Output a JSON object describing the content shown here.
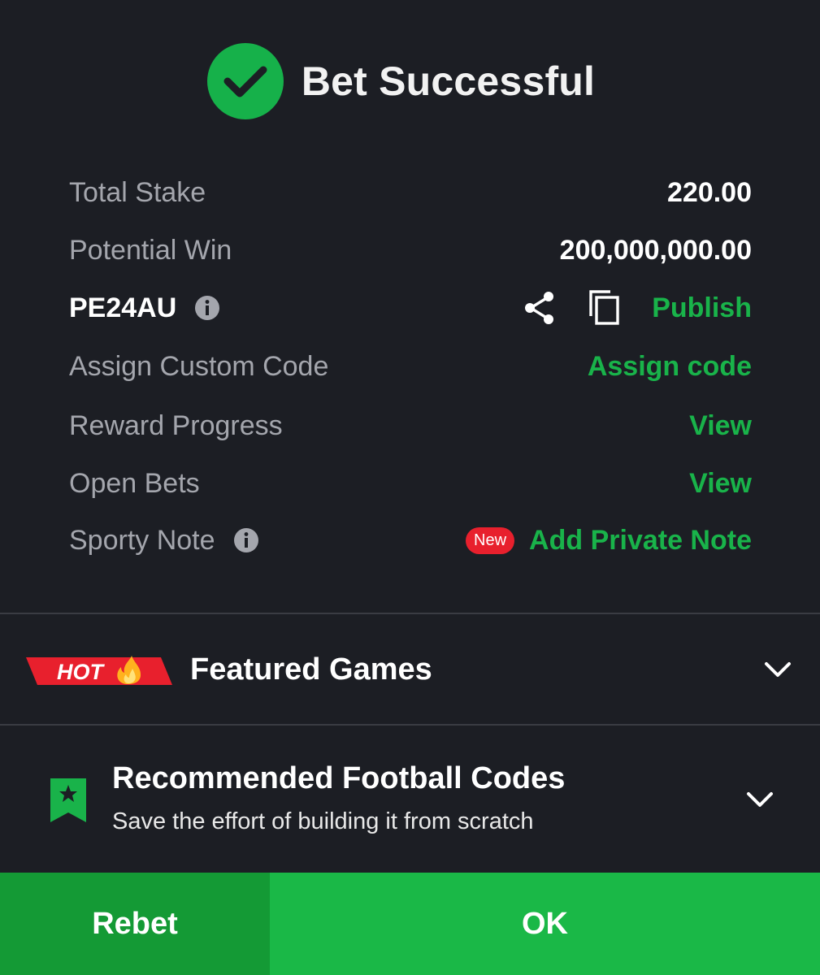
{
  "header": {
    "title": "Bet Successful",
    "icon": "check-circle-icon"
  },
  "summary": {
    "total_stake": {
      "label": "Total Stake",
      "value": "220.00"
    },
    "potential_win": {
      "label": "Potential Win",
      "value": "200,000,000.00"
    },
    "booking_code": {
      "code": "PE24AU",
      "publish_label": "Publish"
    },
    "custom_code": {
      "label": "Assign Custom Code",
      "action": "Assign code"
    },
    "reward_progress": {
      "label": "Reward Progress",
      "action": "View"
    },
    "open_bets": {
      "label": "Open Bets",
      "action": "View"
    },
    "sporty_note": {
      "label": "Sporty Note",
      "badge": "New",
      "action": "Add Private Note"
    }
  },
  "featured": {
    "badge": "HOT",
    "title": "Featured Games"
  },
  "recommended": {
    "title": "Recommended Football Codes",
    "subtitle": "Save the effort of building it from scratch"
  },
  "buttons": {
    "rebet": "Rebet",
    "ok": "OK"
  },
  "colors": {
    "background": "#1c1e24",
    "accent_green": "#19b34a",
    "rebet_bg": "#149a35",
    "ok_bg": "#1ab847",
    "label_gray": "#a4a6ad",
    "new_badge_red": "#e8202d",
    "hot_badge_red": "#e8202d"
  }
}
